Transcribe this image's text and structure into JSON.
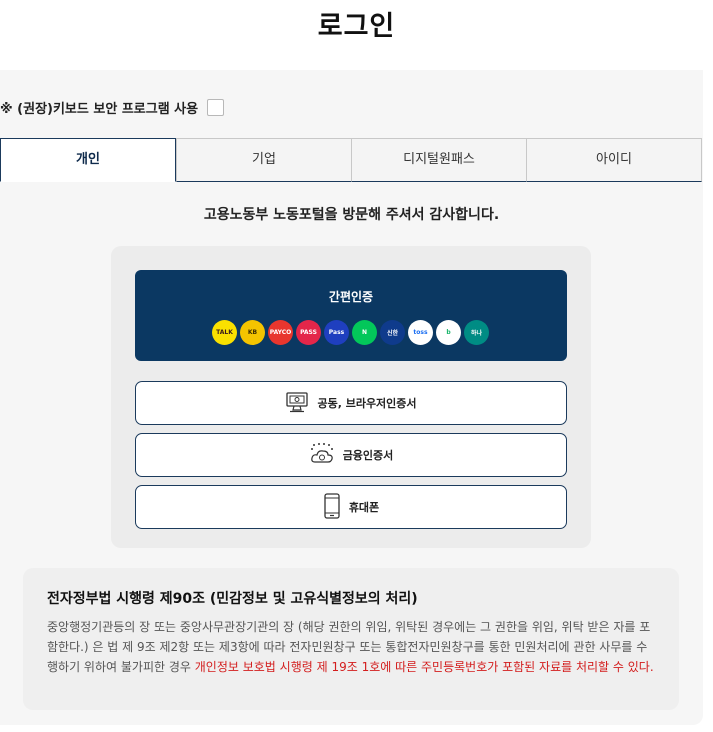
{
  "page": {
    "title": "로그인"
  },
  "keyboard_security": {
    "label": "※ (권장)키보드 보안 프로그램 사용",
    "checked": false
  },
  "tabs": [
    {
      "label": "개인",
      "active": true
    },
    {
      "label": "기업",
      "active": false
    },
    {
      "label": "디지털원패스",
      "active": false
    },
    {
      "label": "아이디",
      "active": false
    }
  ],
  "welcome_text": "고용노동부 노동포털을 방문해 주셔서 감사합니다.",
  "simple_auth": {
    "label": "간편인증",
    "providers": [
      {
        "name": "kakaotalk-icon",
        "text": "TALK",
        "bg": "#fae100",
        "fg": "#3a1d1d"
      },
      {
        "name": "kb-icon",
        "text": "KB",
        "bg": "#f5c400",
        "fg": "#3a2a00"
      },
      {
        "name": "payco-icon",
        "text": "PAYCO",
        "bg": "#e8362e",
        "fg": "#ffffff"
      },
      {
        "name": "pass-icon",
        "text": "PASS",
        "bg": "#e4264a",
        "fg": "#ffffff"
      },
      {
        "name": "samsung-pass-icon",
        "text": "Pass",
        "bg": "#1f3fbf",
        "fg": "#ffffff"
      },
      {
        "name": "naver-icon",
        "text": "N",
        "bg": "#03c75a",
        "fg": "#ffffff"
      },
      {
        "name": "shinhan-icon",
        "text": "신한",
        "bg": "#0f3b8c",
        "fg": "#ffffff"
      },
      {
        "name": "toss-icon",
        "text": "toss",
        "bg": "#ffffff",
        "fg": "#1c6ff2"
      },
      {
        "name": "banksalad-icon",
        "text": "b",
        "bg": "#ffffff",
        "fg": "#19b56b"
      },
      {
        "name": "hana-icon",
        "text": "하나",
        "bg": "#008c84",
        "fg": "#ffffff"
      }
    ]
  },
  "cert_buttons": [
    {
      "label": "공동, 브라우저인증서",
      "icon": "computer-certificate-icon"
    },
    {
      "label": "금융인증서",
      "icon": "cloud-certificate-icon"
    },
    {
      "label": "휴대폰",
      "icon": "mobile-phone-icon"
    }
  ],
  "notice": {
    "title": "전자정부법 시행령 제90조 (민감정보 및 고유식별정보의 처리)",
    "body": "중앙행정기관등의 장 또는 중앙사무관장기관의 장 (해당 권한의 위임, 위탁된 경우에는 그 권한을 위임, 위탁 받은 자를 포함한다.) 은 법 제 9조 제2항 또는 제3항에 따라 전자민원창구 또는 통합전자민원창구를 통한 민원처리에 관한 사무를 수행하기 위하여 불가피한 경우 ",
    "highlight": "개인정보 보호법 시행령 제 19조 1호에 따른 주민등록번호가 포함된 자료를 처리할 수 있다.",
    "highlight_color": "#d31d1d"
  },
  "colors": {
    "navy": "#0b3862",
    "border": "#1b3a5c"
  }
}
